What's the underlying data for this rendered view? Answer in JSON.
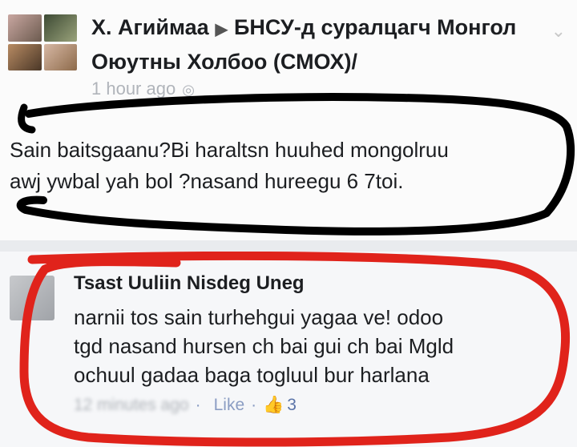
{
  "post": {
    "author": "Х. Агиймаа",
    "arrow_icon": "right-triangle-icon",
    "group": "БНСУ-д суралцагч Монгол Оюутны Холбоо (СМОХ)/",
    "timestamp": "1 hour ago",
    "text_line1": "Sain baitsgaanu?Bi haraltsn huuhed mongolruu",
    "text_line2": "awj ywbal yah bol ?nasand hureegu 6 7toi."
  },
  "comment": {
    "author": "Tsast Uuliin Nisdeg Uneg",
    "text_line1": "narnii tos sain turhehgui yagaa ve!  odoo",
    "text_line2": "tgd nasand hursen ch bai gui ch bai Mgld",
    "text_line3": "ochuul gadaa baga togluul bur harlana",
    "time": "12 minutes ago",
    "like_label": "Like",
    "separator": "·",
    "like_count": "3"
  },
  "colors": {
    "post_marker": "#000000",
    "comment_marker": "#e0231b",
    "link": "#8b9dc3"
  }
}
